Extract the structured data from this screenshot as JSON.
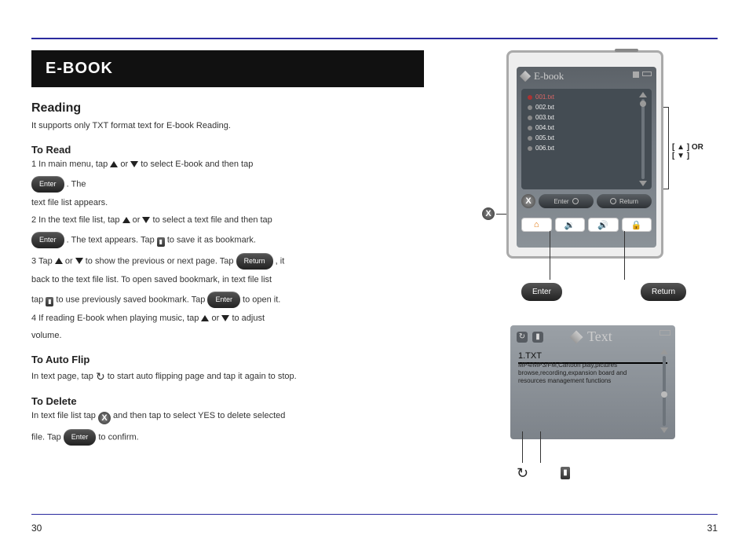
{
  "page_left_number": "30",
  "page_right_number": "31",
  "heading": "E-BOOK",
  "intro_title": "Reading",
  "intro_body": "It supports only TXT format text for E-book Reading.",
  "read_title": "To Read",
  "steps": {
    "s1a": "1  In main menu, tap ",
    "s1b_up": "▲",
    "s1c": " or ",
    "s1d_dn": "▼",
    "s1e": " to select E-book and then tap ",
    "s1_enter": "Enter",
    "s1f": ". The",
    "s1g": "text file list appears.",
    "s2a": "2  In the text file list, tap ",
    "s2b": " or ",
    "s2c": " to select a text file and then tap",
    "s2_enter": "Enter",
    "s2d": ". The text appears. Tap ",
    "s2_bk": "▮",
    "s2e": " to save it as bookmark.",
    "s3a": "3  Tap ",
    "s3b": " or ",
    "s3c": " to show the previous or next page. Tap ",
    "s3_return": "Return",
    "s3d": ", it",
    "s3e": "back to the text file list. To open saved bookmark, in text file list",
    "s3f": "tap ",
    "s3_bk": "▮",
    "s3g": " to use previously saved bookmark. Tap ",
    "s3_enter": "Enter",
    "s3h": " to open it.",
    "s4a": "4  If reading E-book when playing music, tap ",
    "s4b": " or ",
    "s4c": " to adjust",
    "s4d": "volume."
  },
  "sub_auto_title": "To Auto Flip",
  "auto_body_a": "In text page, tap ",
  "auto_body_b": " to start auto flipping page and tap it again to stop.",
  "sub_del_title": "To Delete",
  "del_body_a": "In text file list tap ",
  "del_body_b": " and then tap to select YES to delete selected",
  "del_body_c": "file. Tap ",
  "del_enter": "Enter",
  "del_body_d": " to confirm.",
  "device": {
    "header": "E-book",
    "files": [
      "001.txt",
      "002.txt",
      "003.txt",
      "004.txt",
      "005.txt",
      "006.txt"
    ],
    "foot_enter": "Enter",
    "foot_return": "Return"
  },
  "callout_arrows_label": "[ ▲ ] OR [ ▼ ]",
  "big_enter": "Enter",
  "big_return": "Return",
  "textview": {
    "header": "Text",
    "filename": "1.TXT",
    "body": "MP4/MP3/FM,Cartoon play,pictures browse,recording,expansion board and resources management functions"
  }
}
